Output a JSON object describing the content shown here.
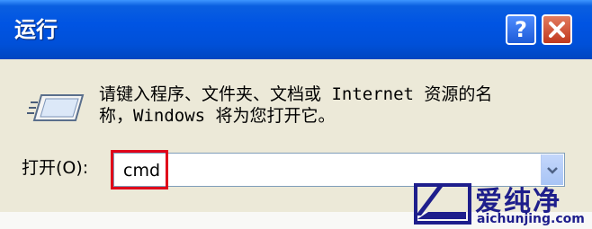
{
  "window": {
    "title": "运行",
    "help_label": "?"
  },
  "dialog": {
    "prompt_line1": "请键入程序、文件夹、文档或 Internet 资源的名",
    "prompt_line2": "称，Windows 将为您打开它。",
    "open_label": "打开(O):",
    "open_value": "cmd"
  },
  "watermark": {
    "brand": "爱纯净",
    "url": "aichunjing.com"
  },
  "colors": {
    "titlebar": "#0054e3",
    "dialog_bg": "#ece9d8",
    "highlight_box": "#e0001a",
    "watermark": "#1e1e8c"
  }
}
